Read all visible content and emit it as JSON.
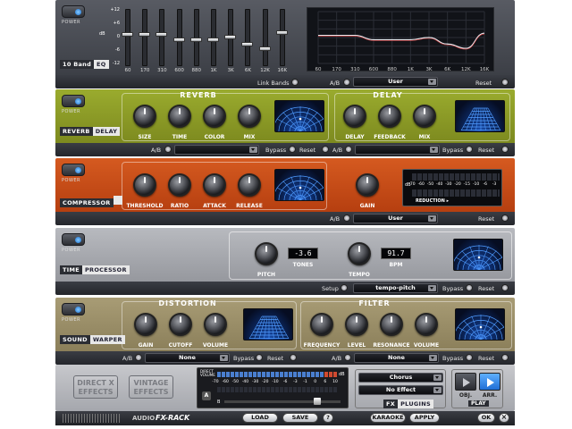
{
  "power_label": "POWER",
  "eq": {
    "tag1": "10 Band",
    "tag2": "EQ",
    "db_ticks": [
      "+12",
      "+6",
      "0",
      "-6",
      "-12"
    ],
    "db_unit": "dB",
    "bands": [
      "60",
      "170",
      "310",
      "600",
      "880",
      "1K",
      "3K",
      "6K",
      "12K",
      "16K"
    ],
    "band_levels_db": [
      1,
      1,
      1,
      -1,
      -1,
      -1,
      0,
      -3,
      -5,
      2
    ],
    "bar": {
      "link_bands": "Link Bands",
      "ab": "A/B",
      "preset": "User",
      "reset": "Reset"
    }
  },
  "reverb_delay": {
    "tag1": "REVERB",
    "tag2": "DELAY",
    "reverb_title": "REVERB",
    "delay_title": "DELAY",
    "reverb_knobs": [
      "SIZE",
      "TIME",
      "COLOR",
      "MIX"
    ],
    "delay_knobs": [
      "DELAY",
      "FEEDBACK",
      "MIX"
    ],
    "bar": {
      "ab": "A/B",
      "bypass": "Bypass",
      "reset": "Reset",
      "ab2": "A/B",
      "bypass2": "Bypass",
      "reset2": "Reset"
    }
  },
  "compressor": {
    "tag1": "COMPRESSOR",
    "knobs": [
      "THRESHOLD",
      "RATIO",
      "ATTACK",
      "RELEASE"
    ],
    "gain_label": "GAIN",
    "meter_db": "dB",
    "meter_scale": [
      "-70",
      "-60",
      "-50",
      "-40",
      "-30",
      "-20",
      "-15",
      "-10",
      "-6",
      "-3"
    ],
    "reduction": "REDUCTION",
    "bar": {
      "ab": "A/B",
      "preset": "User",
      "reset": "Reset"
    }
  },
  "time_processor": {
    "tag1": "TIME",
    "tag2": "PROCESSOR",
    "pitch": "PITCH",
    "tones_value": "-3.6",
    "tones_label": "TONES",
    "tempo": "TEMPO",
    "bpm_value": "91.7",
    "bpm_label": "BPM",
    "bar": {
      "setup": "Setup",
      "preset": "tempo-pitch",
      "bypass": "Bypass",
      "reset": "Reset"
    }
  },
  "sound_warper": {
    "tag1": "SOUND",
    "tag2": "WARPER",
    "distortion_title": "DISTORTION",
    "filter_title": "FILTER",
    "distortion_knobs": [
      "GAIN",
      "CUTOFF",
      "VOLUME"
    ],
    "filter_knobs": [
      "FREQUENCY",
      "LEVEL",
      "RESONANCE",
      "VOLUME"
    ],
    "bar": {
      "ab": "A/B",
      "preset1": "None",
      "bypass": "Bypass",
      "reset": "Reset",
      "ab2": "A/B",
      "preset2": "None",
      "bypass2": "Bypass",
      "reset2": "Reset"
    }
  },
  "bottom": {
    "direct_x": [
      "DIRECT X",
      "EFFECTS"
    ],
    "vintage": [
      "VINTAGE",
      "EFFECTS"
    ],
    "direct_volume": "DIRECT VOLUME",
    "meter_db": "dB",
    "meter_scale": [
      "-70",
      "-60",
      "-50",
      "-40",
      "-30",
      "-20",
      "-10",
      "-6",
      "-3",
      "-1",
      "0",
      "6",
      "10"
    ],
    "channel_a": "A",
    "channel_b": "B",
    "plugin1": "Chorus",
    "plugin2": "No Effect",
    "fx_plugins": [
      "FX",
      "PLUGINS"
    ],
    "obj": "OBJ.",
    "arr": "ARR.",
    "play": "PLAY"
  },
  "footer": {
    "brand1": "AUDIO",
    "brand2": "FX-RACK",
    "load": "LOAD",
    "save": "SAVE",
    "help": "?",
    "karaoke": "KARAOKE",
    "apply": "APPLY",
    "ok": "OK",
    "close": "×"
  }
}
